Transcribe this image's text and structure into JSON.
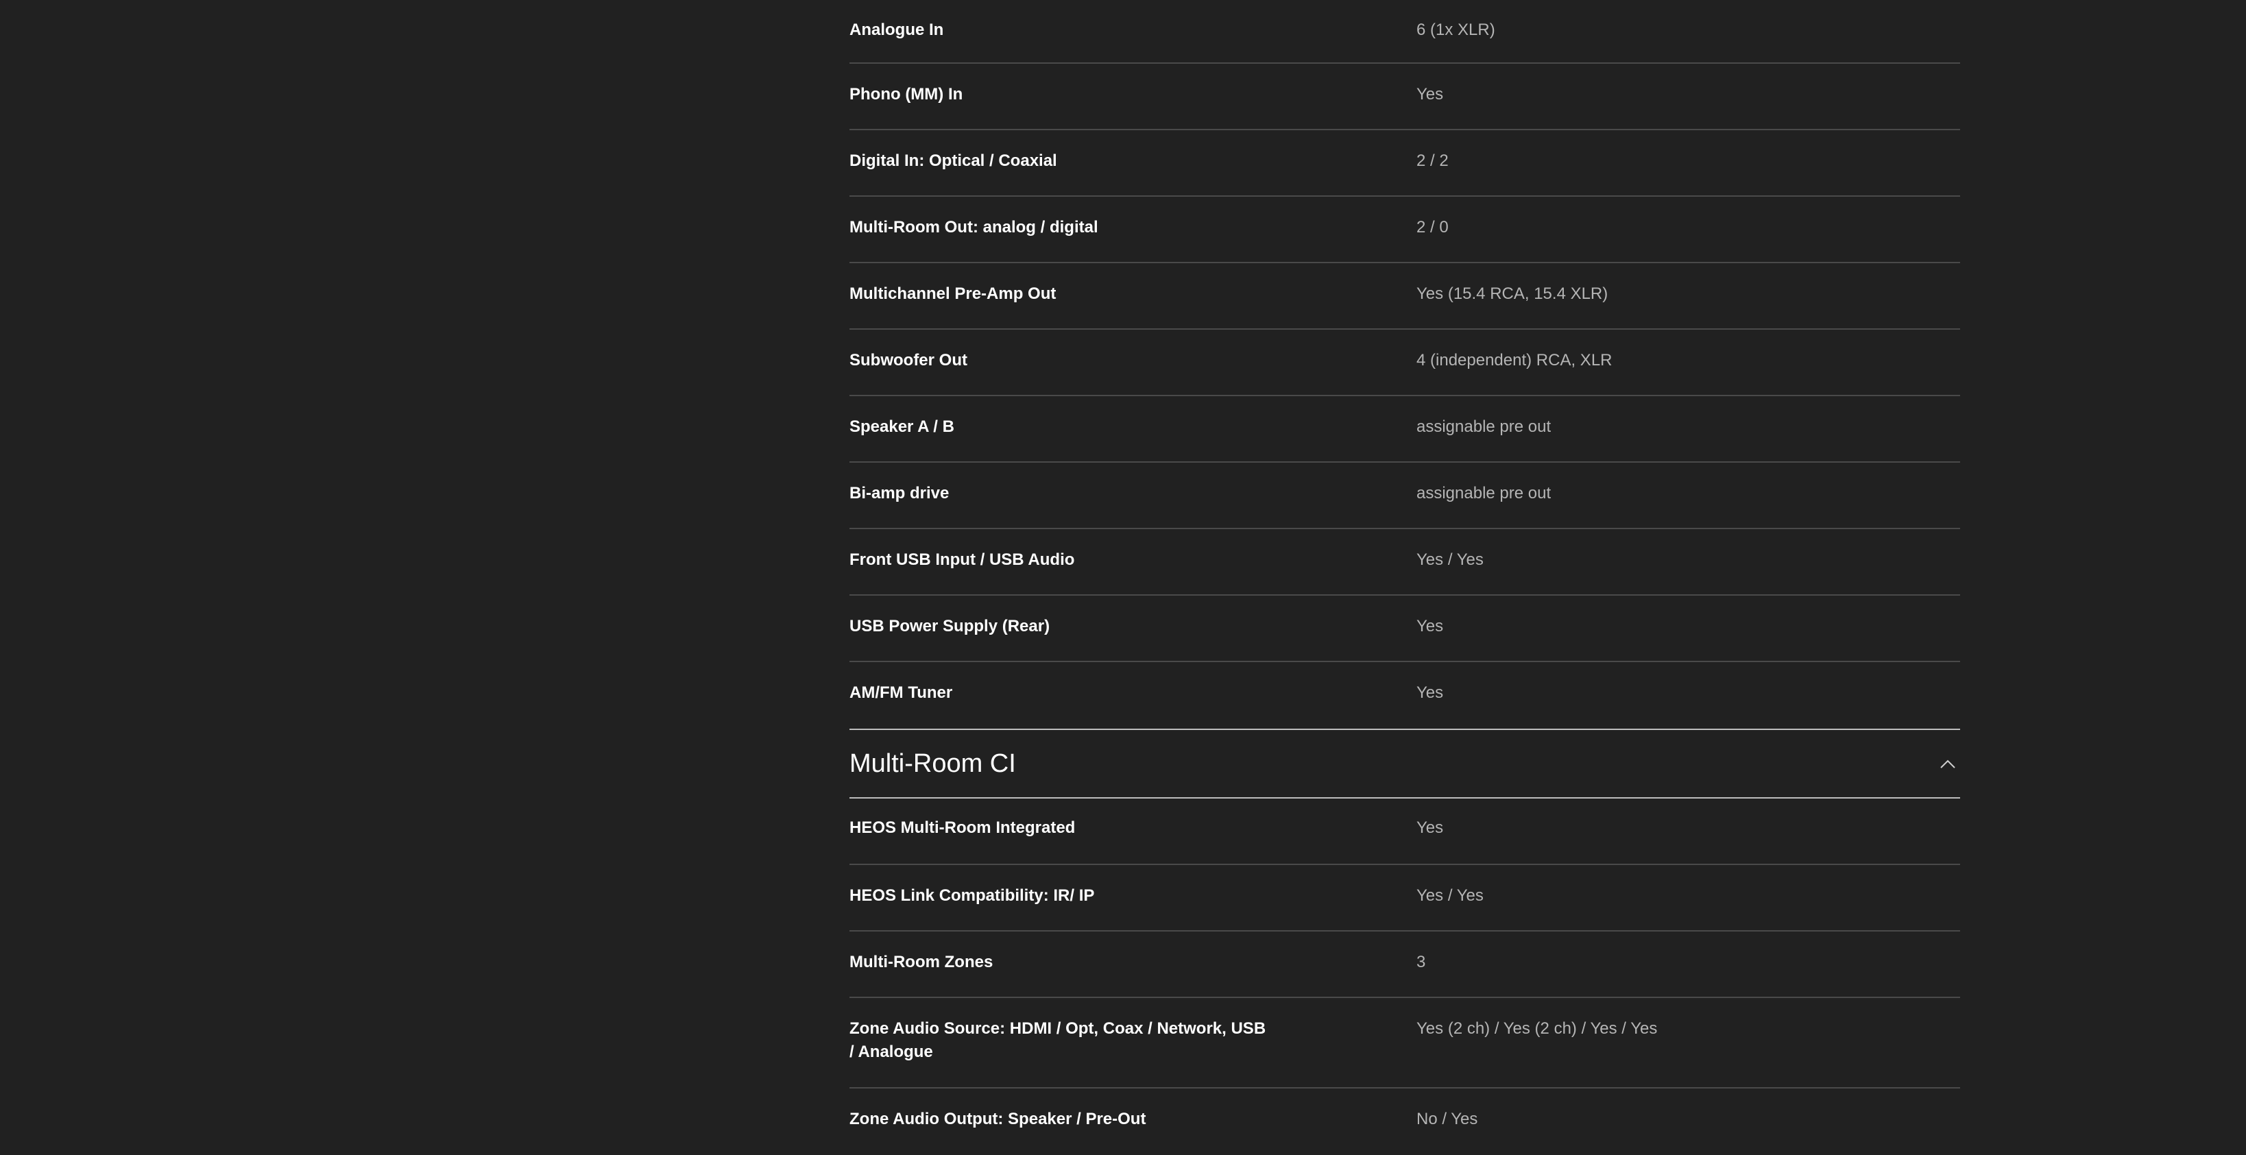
{
  "sections": [
    {
      "rows": [
        {
          "label": "Analogue In",
          "value": "6 (1x XLR)"
        },
        {
          "label": "Phono (MM) In",
          "value": "Yes"
        },
        {
          "label": "Digital In: Optical / Coaxial",
          "value": "2 / 2"
        },
        {
          "label": "Multi-Room Out: analog / digital",
          "value": "2 / 0"
        },
        {
          "label": "Multichannel Pre-Amp Out",
          "value": "Yes (15.4 RCA, 15.4 XLR)"
        },
        {
          "label": "Subwoofer Out",
          "value": "4 (independent) RCA, XLR"
        },
        {
          "label": "Speaker A / B",
          "value": "assignable pre out"
        },
        {
          "label": "Bi-amp drive",
          "value": "assignable pre out"
        },
        {
          "label": "Front USB Input / USB Audio",
          "value": "Yes / Yes"
        },
        {
          "label": "USB Power Supply (Rear)",
          "value": "Yes"
        },
        {
          "label": "AM/FM Tuner",
          "value": "Yes"
        }
      ]
    },
    {
      "title": "Multi-Room CI",
      "toggle_icon": "chevron-up-icon",
      "rows": [
        {
          "label": "HEOS Multi-Room Integrated",
          "value": "Yes"
        },
        {
          "label": "HEOS Link Compatibility: IR/ IP",
          "value": "Yes / Yes"
        },
        {
          "label": "Multi-Room Zones",
          "value": "3"
        },
        {
          "label": "Zone Audio Source: HDMI / Opt, Coax / Network, USB / Analogue",
          "value": "Yes (2 ch) / Yes (2 ch) / Yes / Yes"
        },
        {
          "label": "Zone Audio Output: Speaker / Pre-Out",
          "value": "No / Yes"
        }
      ]
    }
  ]
}
